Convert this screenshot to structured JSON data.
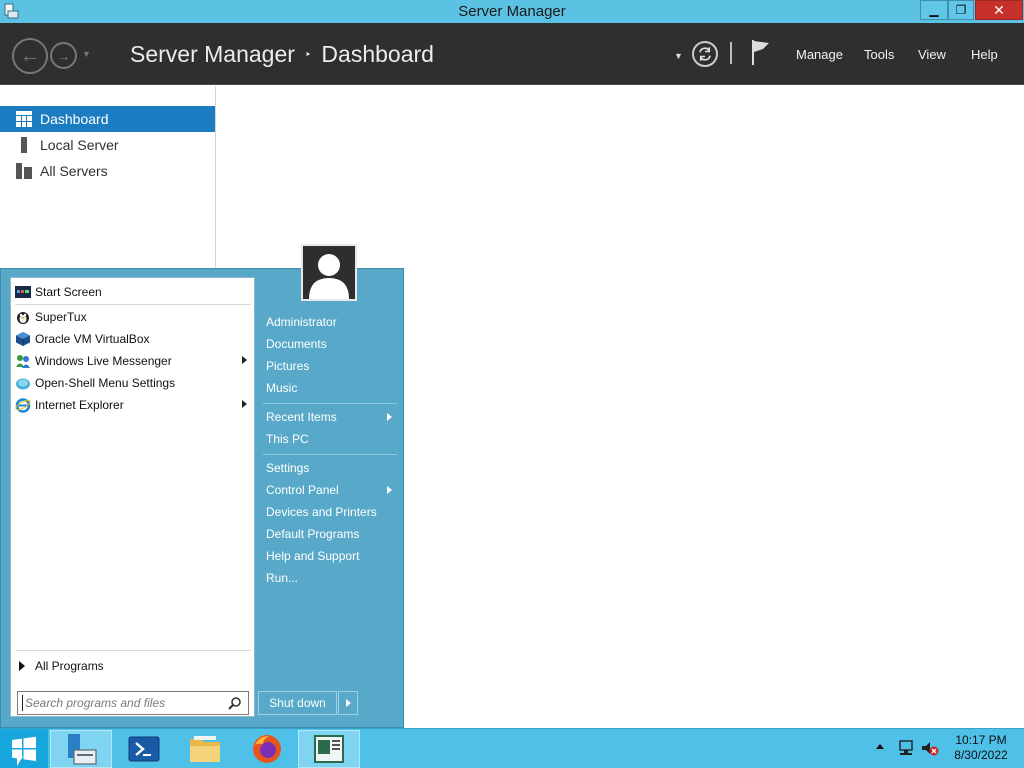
{
  "window": {
    "title": "Server Manager",
    "controls": {
      "minimize": "▁",
      "maximize": "❐",
      "close": "✕"
    }
  },
  "header": {
    "breadcrumb": [
      "Server Manager",
      "Dashboard"
    ],
    "breadcrumb_separator": "‣",
    "menus": [
      "Manage",
      "Tools",
      "View",
      "Help"
    ]
  },
  "nav": {
    "items": [
      {
        "label": "Dashboard",
        "icon": "dashboard-grid-icon",
        "active": true
      },
      {
        "label": "Local Server",
        "icon": "server-icon",
        "active": false
      },
      {
        "label": "All Servers",
        "icon": "servers-icon",
        "active": false
      }
    ]
  },
  "start_menu": {
    "pinned": [
      {
        "label": "Start Screen",
        "icon": "start-screen-icon"
      }
    ],
    "programs": [
      {
        "label": "SuperTux",
        "icon": "supertux-icon",
        "submenu": false
      },
      {
        "label": "Oracle VM VirtualBox",
        "icon": "virtualbox-icon",
        "submenu": false
      },
      {
        "label": "Windows Live Messenger",
        "icon": "messenger-icon",
        "submenu": true
      },
      {
        "label": "Open-Shell Menu Settings",
        "icon": "open-shell-icon",
        "submenu": false
      },
      {
        "label": "Internet Explorer",
        "icon": "internet-explorer-icon",
        "submenu": true
      }
    ],
    "all_programs": "All Programs",
    "search_placeholder": "Search programs and files",
    "places_group1": [
      "Administrator",
      "Documents",
      "Pictures",
      "Music"
    ],
    "places_group2": [
      {
        "label": "Recent Items",
        "submenu": true
      },
      {
        "label": "This PC",
        "submenu": false
      }
    ],
    "places_group3": [
      {
        "label": "Settings",
        "submenu": false
      },
      {
        "label": "Control Panel",
        "submenu": true
      },
      {
        "label": "Devices and Printers",
        "submenu": false
      },
      {
        "label": "Default Programs",
        "submenu": false
      },
      {
        "label": "Help and Support",
        "submenu": false
      },
      {
        "label": "Run...",
        "submenu": false
      }
    ],
    "shutdown_label": "Shut down"
  },
  "taskbar": {
    "apps": [
      "server-manager-icon",
      "powershell-icon",
      "file-explorer-icon",
      "firefox-icon",
      "task-window-icon"
    ],
    "clock": {
      "time": "10:17 PM",
      "date": "8/30/2022"
    }
  },
  "colors": {
    "titlebar": "#5cc2e4",
    "header": "#2f2f2f",
    "nav_active": "#1c7cc1",
    "start_menu": "#58a9c9",
    "taskbar": "#4fc0e8",
    "close_button": "#c7312b"
  }
}
